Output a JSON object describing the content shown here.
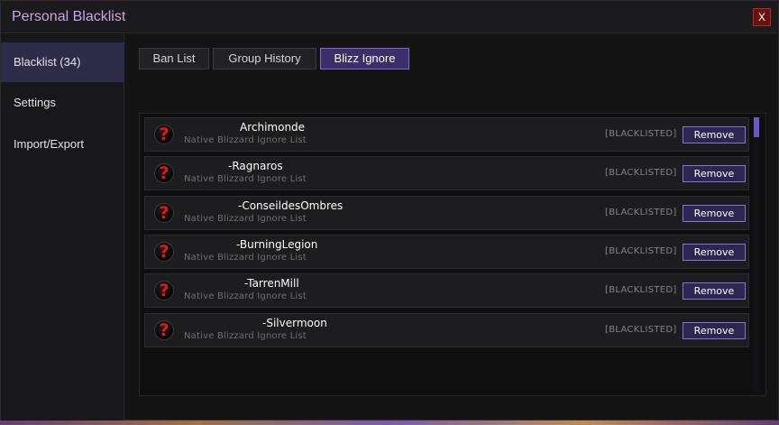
{
  "window": {
    "title": "Personal Blacklist",
    "close_label": "X"
  },
  "sidebar": {
    "items": [
      {
        "label": "Blacklist (34)"
      },
      {
        "label": "Settings"
      },
      {
        "label": "Import/Export"
      }
    ]
  },
  "tabs": [
    {
      "label": "Ban List"
    },
    {
      "label": "Group History"
    },
    {
      "label": "Blizz Ignore"
    }
  ],
  "entries": [
    {
      "name": "Archimonde",
      "source": "Native Blizzard Ignore List",
      "status": "[BLACKLISTED]",
      "action": "Remove"
    },
    {
      "name": "-Ragnaros",
      "source": "Native Blizzard Ignore List",
      "status": "[BLACKLISTED]",
      "action": "Remove"
    },
    {
      "name": "-ConseildesOmbres",
      "source": "Native Blizzard Ignore List",
      "status": "[BLACKLISTED]",
      "action": "Remove"
    },
    {
      "name": "-BurningLegion",
      "source": "Native Blizzard Ignore List",
      "status": "[BLACKLISTED]",
      "action": "Remove"
    },
    {
      "name": "-TarrenMill",
      "source": "Native Blizzard Ignore List",
      "status": "[BLACKLISTED]",
      "action": "Remove"
    },
    {
      "name": "-Silvermoon",
      "source": "Native Blizzard Ignore List",
      "status": "[BLACKLISTED]",
      "action": "Remove"
    }
  ],
  "icons": {
    "entry": "question-mark-icon",
    "icon_glyph": "?"
  },
  "colors": {
    "accent": "#7c68c9",
    "title": "#c9a5e6",
    "icon_red": "#e01818"
  }
}
